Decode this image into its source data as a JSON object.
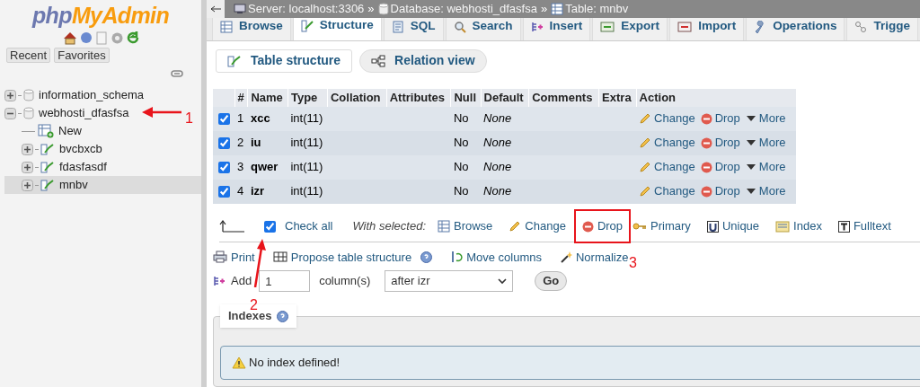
{
  "sidebar": {
    "logo": {
      "part_1": "php",
      "part_2": "MyAdmin"
    },
    "buttons": [
      "Recent",
      "Favorites"
    ],
    "tree": [
      {
        "label": "information_schema",
        "expanded": false,
        "selected": false,
        "kind": "database"
      },
      {
        "label": "webhosti_dfasfsa",
        "expanded": true,
        "selected": false,
        "kind": "database",
        "children": [
          {
            "label": "New",
            "kind": "new",
            "selected": false
          },
          {
            "label": "bvcbxcb",
            "kind": "table",
            "expanded": false,
            "selected": false
          },
          {
            "label": "fdasfasdf",
            "kind": "table",
            "expanded": false,
            "selected": false
          },
          {
            "label": "mnbv",
            "kind": "table",
            "expanded": false,
            "selected": true
          }
        ]
      }
    ]
  },
  "breadcrumb": [
    {
      "label": "Server: localhost:3306",
      "separator": "»"
    },
    {
      "label": "Database: webhosti_dfasfsa",
      "separator": "»"
    },
    {
      "label": "Table: mnbv"
    }
  ],
  "tabs": [
    {
      "label": "Browse",
      "selected": false
    },
    {
      "label": "Structure",
      "selected": true
    },
    {
      "label": "SQL",
      "selected": false
    },
    {
      "label": "Search",
      "selected": false
    },
    {
      "label": "Insert",
      "selected": false
    },
    {
      "label": "Export",
      "selected": false
    },
    {
      "label": "Import",
      "selected": false
    },
    {
      "label": "Operations",
      "selected": false
    },
    {
      "label": "Trigge",
      "selected": false
    }
  ],
  "subtabs": [
    {
      "label": "Table structure",
      "selected": true
    },
    {
      "label": "Relation view",
      "selected": false
    }
  ],
  "table": {
    "columns": [
      "#",
      "Name",
      "Type",
      "Collation",
      "Attributes",
      "Null",
      "Default",
      "Comments",
      "Extra",
      "Action"
    ],
    "rows": [
      {
        "checked": true,
        "cells": [
          "1",
          "xcc",
          "int(11)",
          "",
          "",
          "No",
          "None",
          ""
        ],
        "actions": [
          "Change",
          "Drop",
          "More"
        ]
      },
      {
        "checked": true,
        "cells": [
          "2",
          "iu",
          "int(11)",
          "",
          "",
          "No",
          "None",
          ""
        ],
        "actions": [
          "Change",
          "Drop",
          "More"
        ]
      },
      {
        "checked": true,
        "cells": [
          "3",
          "qwer",
          "int(11)",
          "",
          "",
          "No",
          "None",
          ""
        ],
        "actions": [
          "Change",
          "Drop",
          "More"
        ]
      },
      {
        "checked": true,
        "cells": [
          "4",
          "izr",
          "int(11)",
          "",
          "",
          "No",
          "None",
          ""
        ],
        "actions": [
          "Change",
          "Drop",
          "More"
        ]
      }
    ]
  },
  "bulk": {
    "check_all": {
      "label": "Check all",
      "checked": true
    },
    "with_selected": "With selected:",
    "actions": [
      {
        "label": "Browse",
        "highlighted": false
      },
      {
        "label": "Change",
        "highlighted": false
      },
      {
        "label": "Drop",
        "highlighted": true
      },
      {
        "label": "Primary",
        "highlighted": false
      },
      {
        "label": "Unique",
        "highlighted": false
      },
      {
        "label": "Index",
        "highlighted": false
      },
      {
        "label": "Fulltext",
        "highlighted": false
      }
    ]
  },
  "tools": [
    "Print",
    "Propose table structure",
    "Move columns",
    "Normalize"
  ],
  "add_column": {
    "label": "Add",
    "value": "1",
    "unit": "column(s)",
    "position": "after izr",
    "button": "Go"
  },
  "indexes": {
    "title": "Indexes",
    "message": "No index defined!"
  },
  "annotations": [
    "1",
    "2",
    "3"
  ]
}
